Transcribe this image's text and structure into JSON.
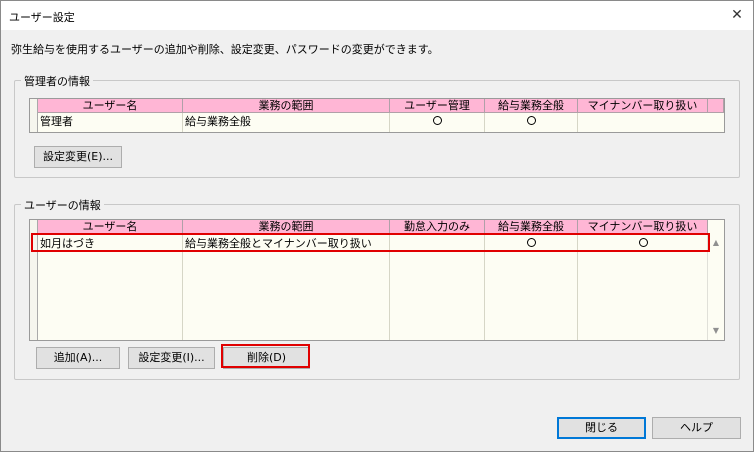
{
  "window": {
    "title": "ユーザー設定",
    "close_glyph": "✕"
  },
  "description": "弥生給与を使用するユーザーの追加や削除、設定変更、パスワードの変更ができます。",
  "admin": {
    "group_title": "管理者の情報",
    "headers": [
      "ユーザー名",
      "業務の範囲",
      "ユーザー管理",
      "給与業務全般",
      "マイナンバー取り扱い"
    ],
    "row": {
      "name": "管理者",
      "scope": "給与業務全般",
      "user_mgmt": true,
      "payroll": true,
      "mynumber": false
    },
    "settings_button": "設定変更(E)..."
  },
  "users": {
    "group_title": "ユーザーの情報",
    "headers": [
      "ユーザー名",
      "業務の範囲",
      "勤怠入力のみ",
      "給与業務全般",
      "マイナンバー取り扱い"
    ],
    "rows": [
      {
        "name": "如月はづき",
        "scope": "給与業務全般とマイナンバー取り扱い",
        "attendance_only": false,
        "payroll": true,
        "mynumber": true
      }
    ],
    "add_button": "追加(A)...",
    "settings_button": "設定変更(I)...",
    "delete_button": "削除(D)"
  },
  "footer": {
    "close_button": "閉じる",
    "help_button": "ヘルプ"
  },
  "colors": {
    "header_bg": "#ffb6d5",
    "grid_bg": "#fdfdf3",
    "highlight": "#e00000"
  },
  "icons": {
    "close": "close-icon",
    "scroll_up": "scroll-up-icon",
    "scroll_down": "scroll-down-icon",
    "check": "circle-mark-icon"
  }
}
